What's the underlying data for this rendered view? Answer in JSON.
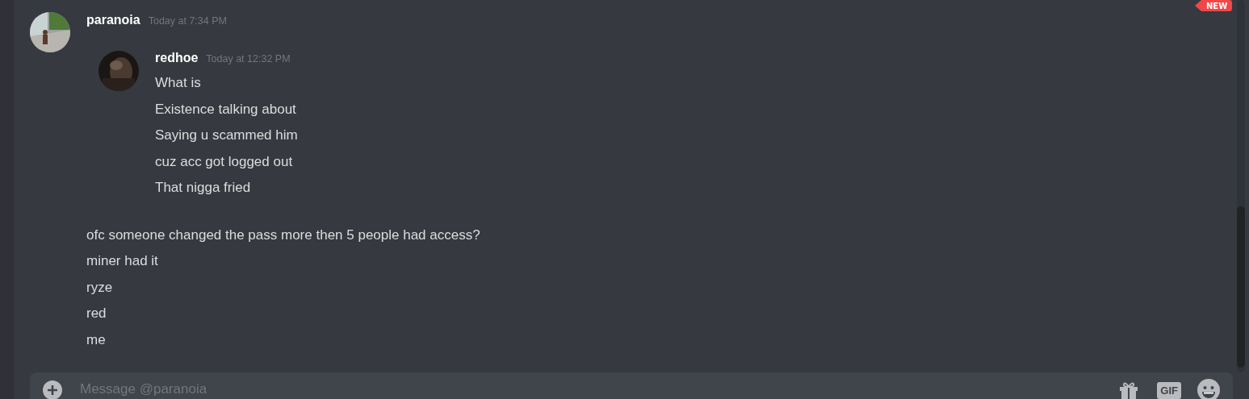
{
  "new_badge": "NEW",
  "message": {
    "author": "paranoia",
    "timestamp": "Today at 7:34 PM",
    "quote": {
      "author": "redhoe",
      "timestamp": "Today at 12:32 PM",
      "lines": [
        "What is",
        "Existence talking about",
        "Saying u scammed him",
        "cuz acc got logged out",
        "That nigga fried"
      ]
    },
    "lines": [
      "ofc someone changed the pass more then 5 people had access?",
      "miner had it",
      "ryze",
      "red",
      "me"
    ]
  },
  "composer": {
    "placeholder": "Message @paranoia",
    "gif_label": "GIF"
  }
}
